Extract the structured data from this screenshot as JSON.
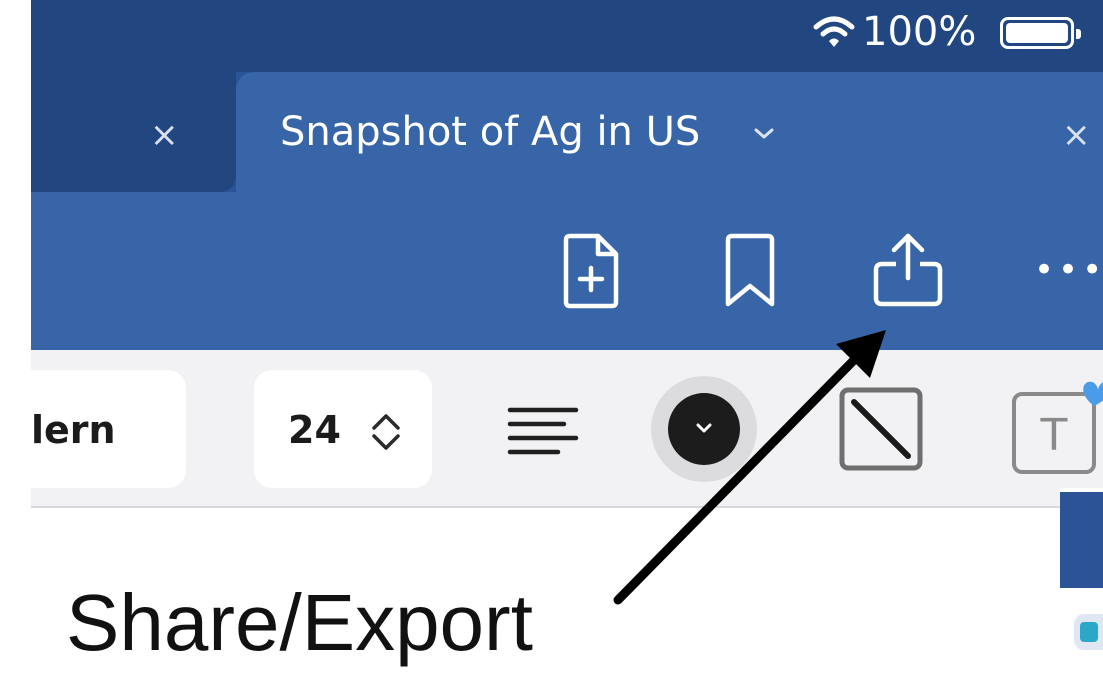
{
  "status_bar": {
    "battery_percent": "100%",
    "battery_level": 1.0,
    "wifi_icon": "wifi-icon"
  },
  "tabs": [
    {
      "label": "",
      "active": false,
      "close": "×"
    },
    {
      "label": "Snapshot of Ag in US",
      "active": true,
      "dropdown": "⌄",
      "close": "×"
    }
  ],
  "toolbar": {
    "icons": [
      "add-page-icon",
      "bookmark-icon",
      "share-icon",
      "more-icon"
    ],
    "more_glyph": "•••"
  },
  "format_bar": {
    "font_name": "lern",
    "font_size": "24",
    "align_icon": "align-left-icon",
    "color_dropdown_icon": "chevron-down-icon",
    "stroke_icon": "diagonal-line-icon",
    "text_box_icon": "text-box-icon",
    "text_glyph": "T"
  },
  "annotation": {
    "caption": "Share/Export",
    "arrow_target": "share-button"
  },
  "colors": {
    "chrome_dark": "#224780",
    "chrome": "#2c5395",
    "tab_active": "#3765a8",
    "format_bar": "#f2f2f4",
    "accent_heart": "#4a9be8"
  }
}
